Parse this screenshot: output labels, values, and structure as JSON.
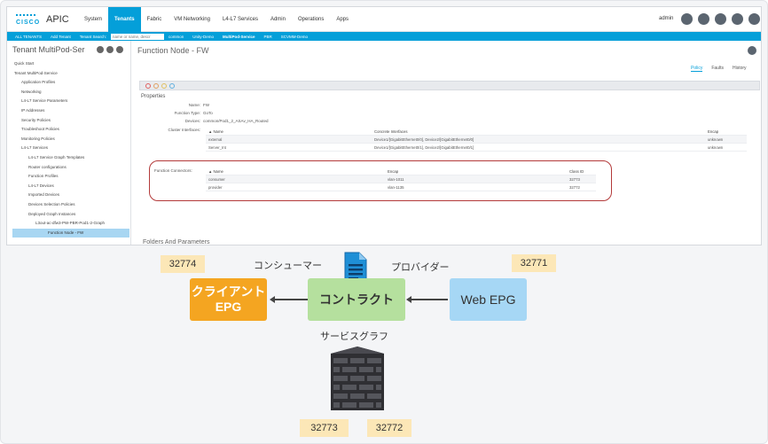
{
  "app": {
    "logo": "CISCO",
    "title": "APIC",
    "menu": [
      "System",
      "Tenants",
      "Fabric",
      "VM Networking",
      "L4-L7 Services",
      "Admin",
      "Operations",
      "Apps"
    ],
    "active_menu": "Tenants",
    "user": "admin"
  },
  "subnav": {
    "items": [
      "ALL TENANTS",
      "Add Tenant",
      "Tenant Search:",
      "name or name, descr",
      "common",
      "Unity-Demo",
      "MultiPod-Service",
      "PBR",
      "SCVMM-Demo"
    ]
  },
  "left": {
    "title": "Tenant MultiPod-Ser",
    "tree": [
      "Quick Start",
      "Tenant MultiPod-Service",
      "Application Profiles",
      "Networking",
      "L4-L7 Service Parameters",
      "IP Addresses",
      "Security Policies",
      "Troubleshoot Policies",
      "Monitoring Policies",
      "L4-L7 Services",
      "L4-L7 Service Graph Templates",
      "Router configurations",
      "Function Profiles",
      "L4-L7 Devices",
      "Imported Devices",
      "Devices Selection Policies",
      "Deployed Graph Instances",
      "L3out-ac-dfw3-PW-PBR-Pod1-2-Graph",
      "Function Node - FW"
    ]
  },
  "main": {
    "title": "Function Node - FW",
    "tabs": [
      "Policy",
      "Faults",
      "History"
    ],
    "properties_heading": "Properties",
    "props": [
      {
        "key": "Name:",
        "value": "FW"
      },
      {
        "key": "Function Type:",
        "value": "GoTo"
      },
      {
        "key": "Devices:",
        "value": "common/Pod1_2_ASAv_HA_Routed"
      },
      {
        "key": "Cluster Interfaces:",
        "value": ""
      }
    ],
    "cluster_table": {
      "headers": [
        "▲ Name",
        "Concrete Interfaces",
        "Encap"
      ],
      "rows": [
        [
          "external",
          "Device1/[GigabitEthernet0/0], Device2/[GigabitEthernet0/0]",
          "unknown"
        ],
        [
          "Server_Int",
          "Device1/[GigabitEthernet0/1], Device2/[GigabitEthernet0/1]",
          "unknown"
        ]
      ]
    },
    "func_connectors_label": "Function Connectors:",
    "func_table": {
      "headers": [
        "▲ Name",
        "Encap",
        "Class ID"
      ],
      "rows": [
        [
          "consumer",
          "vlan-1011",
          "32773"
        ],
        [
          "provider",
          "vlan-1135",
          "32772"
        ]
      ]
    },
    "folders": "Folders And Parameters"
  },
  "diagram": {
    "tag_client": "32774",
    "tag_web": "32771",
    "tag_fw_left": "32773",
    "tag_fw_right": "32772",
    "consumer_label": "コンシューマー",
    "provider_label": "プロバイダー",
    "client_box": [
      "クライアント",
      "EPG"
    ],
    "contract_box": "コントラクト",
    "web_box": "Web EPG",
    "graph_label": "サービスグラフ",
    "colors": {
      "client": "#f4a521",
      "contract": "#b5e09e",
      "web": "#a6d7f5",
      "tag": "#fce7b7",
      "accent": "#049fd9",
      "highlight": "#b33a3a"
    }
  }
}
